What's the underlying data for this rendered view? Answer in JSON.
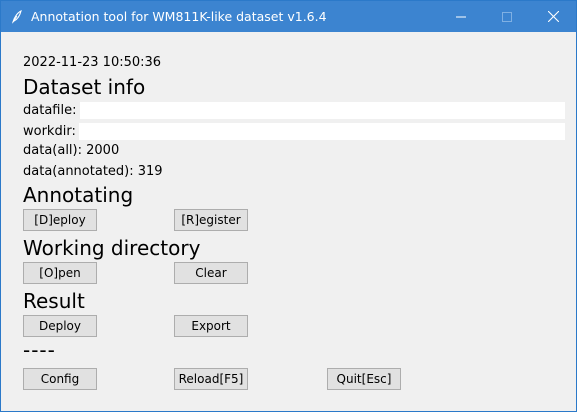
{
  "window": {
    "title": "Annotation tool for WM811K-like dataset v1.6.4",
    "icons": {
      "app": "feather-icon",
      "minimize": "minimize-icon",
      "maximize": "maximize-icon",
      "close": "close-icon"
    }
  },
  "timestamp": "2022-11-23 10:50:36",
  "dataset_info": {
    "heading": "Dataset info",
    "datafile_label": "datafile:",
    "datafile_value": "",
    "workdir_label": "workdir:",
    "workdir_value": "",
    "data_all": "data(all): 2000",
    "data_annotated": "data(annotated): 319"
  },
  "annotating": {
    "heading": "Annotating",
    "deploy_label": "[D]eploy",
    "register_label": "[R]egister"
  },
  "working_directory": {
    "heading": "Working directory",
    "open_label": "[O]pen",
    "clear_label": "Clear"
  },
  "result": {
    "heading": "Result",
    "deploy_label": "Deploy",
    "export_label": "Export"
  },
  "separator": "----",
  "footer": {
    "config_label": "Config",
    "reload_label": "Reload[F5]",
    "quit_label": "Quit[Esc]"
  }
}
